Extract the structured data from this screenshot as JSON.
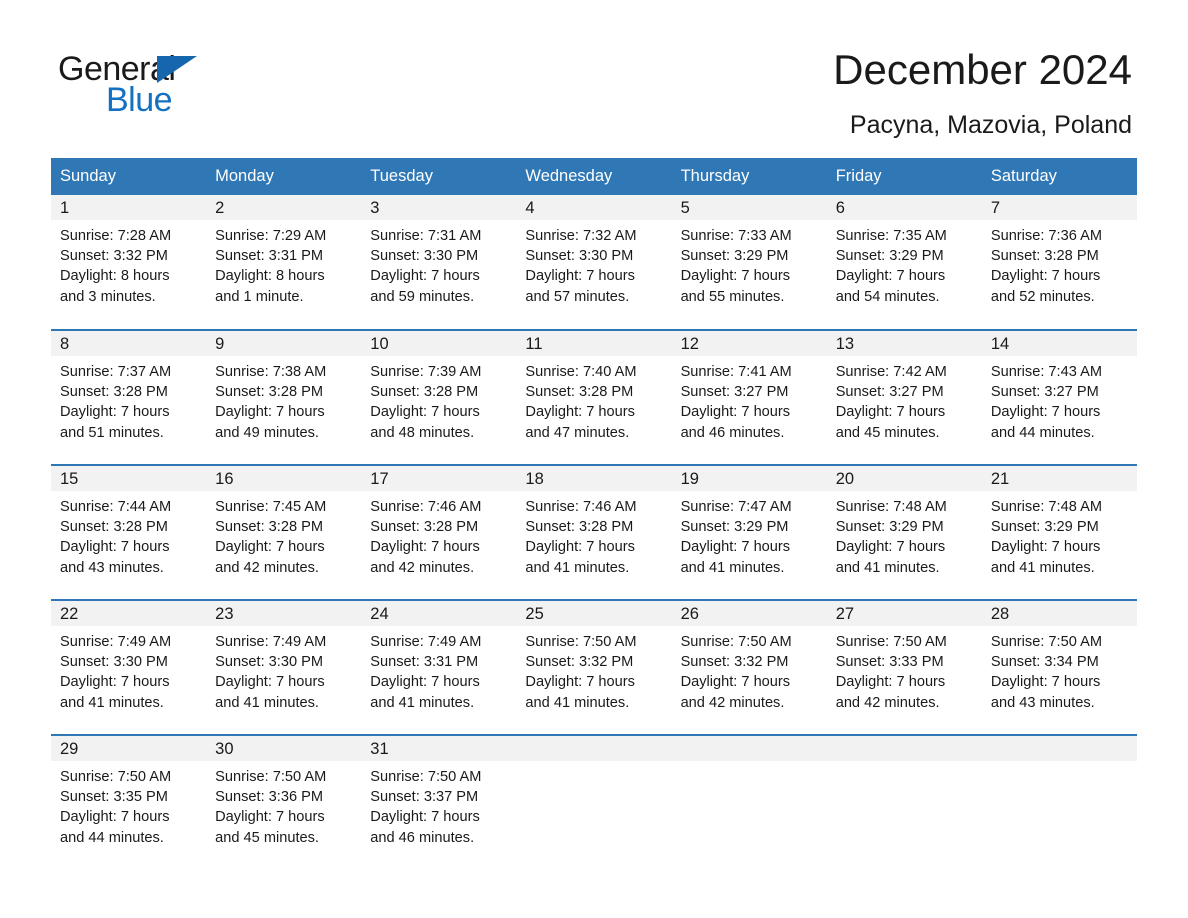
{
  "brand": {
    "name_top": "General",
    "name_bottom": "Blue",
    "accent_color": "#1271c0",
    "triangle_color": "#1566ad"
  },
  "header": {
    "title": "December 2024",
    "location": "Pacyna, Mazovia, Poland"
  },
  "calendar": {
    "header_bg": "#3077b5",
    "header_text_color": "#ffffff",
    "daynum_bg": "#f2f2f2",
    "weekday_headers": [
      "Sunday",
      "Monday",
      "Tuesday",
      "Wednesday",
      "Thursday",
      "Friday",
      "Saturday"
    ],
    "weeks": [
      [
        {
          "day": "1",
          "sunrise": "Sunrise: 7:28 AM",
          "sunset": "Sunset: 3:32 PM",
          "daylight1": "Daylight: 8 hours",
          "daylight2": "and 3 minutes."
        },
        {
          "day": "2",
          "sunrise": "Sunrise: 7:29 AM",
          "sunset": "Sunset: 3:31 PM",
          "daylight1": "Daylight: 8 hours",
          "daylight2": "and 1 minute."
        },
        {
          "day": "3",
          "sunrise": "Sunrise: 7:31 AM",
          "sunset": "Sunset: 3:30 PM",
          "daylight1": "Daylight: 7 hours",
          "daylight2": "and 59 minutes."
        },
        {
          "day": "4",
          "sunrise": "Sunrise: 7:32 AM",
          "sunset": "Sunset: 3:30 PM",
          "daylight1": "Daylight: 7 hours",
          "daylight2": "and 57 minutes."
        },
        {
          "day": "5",
          "sunrise": "Sunrise: 7:33 AM",
          "sunset": "Sunset: 3:29 PM",
          "daylight1": "Daylight: 7 hours",
          "daylight2": "and 55 minutes."
        },
        {
          "day": "6",
          "sunrise": "Sunrise: 7:35 AM",
          "sunset": "Sunset: 3:29 PM",
          "daylight1": "Daylight: 7 hours",
          "daylight2": "and 54 minutes."
        },
        {
          "day": "7",
          "sunrise": "Sunrise: 7:36 AM",
          "sunset": "Sunset: 3:28 PM",
          "daylight1": "Daylight: 7 hours",
          "daylight2": "and 52 minutes."
        }
      ],
      [
        {
          "day": "8",
          "sunrise": "Sunrise: 7:37 AM",
          "sunset": "Sunset: 3:28 PM",
          "daylight1": "Daylight: 7 hours",
          "daylight2": "and 51 minutes."
        },
        {
          "day": "9",
          "sunrise": "Sunrise: 7:38 AM",
          "sunset": "Sunset: 3:28 PM",
          "daylight1": "Daylight: 7 hours",
          "daylight2": "and 49 minutes."
        },
        {
          "day": "10",
          "sunrise": "Sunrise: 7:39 AM",
          "sunset": "Sunset: 3:28 PM",
          "daylight1": "Daylight: 7 hours",
          "daylight2": "and 48 minutes."
        },
        {
          "day": "11",
          "sunrise": "Sunrise: 7:40 AM",
          "sunset": "Sunset: 3:28 PM",
          "daylight1": "Daylight: 7 hours",
          "daylight2": "and 47 minutes."
        },
        {
          "day": "12",
          "sunrise": "Sunrise: 7:41 AM",
          "sunset": "Sunset: 3:27 PM",
          "daylight1": "Daylight: 7 hours",
          "daylight2": "and 46 minutes."
        },
        {
          "day": "13",
          "sunrise": "Sunrise: 7:42 AM",
          "sunset": "Sunset: 3:27 PM",
          "daylight1": "Daylight: 7 hours",
          "daylight2": "and 45 minutes."
        },
        {
          "day": "14",
          "sunrise": "Sunrise: 7:43 AM",
          "sunset": "Sunset: 3:27 PM",
          "daylight1": "Daylight: 7 hours",
          "daylight2": "and 44 minutes."
        }
      ],
      [
        {
          "day": "15",
          "sunrise": "Sunrise: 7:44 AM",
          "sunset": "Sunset: 3:28 PM",
          "daylight1": "Daylight: 7 hours",
          "daylight2": "and 43 minutes."
        },
        {
          "day": "16",
          "sunrise": "Sunrise: 7:45 AM",
          "sunset": "Sunset: 3:28 PM",
          "daylight1": "Daylight: 7 hours",
          "daylight2": "and 42 minutes."
        },
        {
          "day": "17",
          "sunrise": "Sunrise: 7:46 AM",
          "sunset": "Sunset: 3:28 PM",
          "daylight1": "Daylight: 7 hours",
          "daylight2": "and 42 minutes."
        },
        {
          "day": "18",
          "sunrise": "Sunrise: 7:46 AM",
          "sunset": "Sunset: 3:28 PM",
          "daylight1": "Daylight: 7 hours",
          "daylight2": "and 41 minutes."
        },
        {
          "day": "19",
          "sunrise": "Sunrise: 7:47 AM",
          "sunset": "Sunset: 3:29 PM",
          "daylight1": "Daylight: 7 hours",
          "daylight2": "and 41 minutes."
        },
        {
          "day": "20",
          "sunrise": "Sunrise: 7:48 AM",
          "sunset": "Sunset: 3:29 PM",
          "daylight1": "Daylight: 7 hours",
          "daylight2": "and 41 minutes."
        },
        {
          "day": "21",
          "sunrise": "Sunrise: 7:48 AM",
          "sunset": "Sunset: 3:29 PM",
          "daylight1": "Daylight: 7 hours",
          "daylight2": "and 41 minutes."
        }
      ],
      [
        {
          "day": "22",
          "sunrise": "Sunrise: 7:49 AM",
          "sunset": "Sunset: 3:30 PM",
          "daylight1": "Daylight: 7 hours",
          "daylight2": "and 41 minutes."
        },
        {
          "day": "23",
          "sunrise": "Sunrise: 7:49 AM",
          "sunset": "Sunset: 3:30 PM",
          "daylight1": "Daylight: 7 hours",
          "daylight2": "and 41 minutes."
        },
        {
          "day": "24",
          "sunrise": "Sunrise: 7:49 AM",
          "sunset": "Sunset: 3:31 PM",
          "daylight1": "Daylight: 7 hours",
          "daylight2": "and 41 minutes."
        },
        {
          "day": "25",
          "sunrise": "Sunrise: 7:50 AM",
          "sunset": "Sunset: 3:32 PM",
          "daylight1": "Daylight: 7 hours",
          "daylight2": "and 41 minutes."
        },
        {
          "day": "26",
          "sunrise": "Sunrise: 7:50 AM",
          "sunset": "Sunset: 3:32 PM",
          "daylight1": "Daylight: 7 hours",
          "daylight2": "and 42 minutes."
        },
        {
          "day": "27",
          "sunrise": "Sunrise: 7:50 AM",
          "sunset": "Sunset: 3:33 PM",
          "daylight1": "Daylight: 7 hours",
          "daylight2": "and 42 minutes."
        },
        {
          "day": "28",
          "sunrise": "Sunrise: 7:50 AM",
          "sunset": "Sunset: 3:34 PM",
          "daylight1": "Daylight: 7 hours",
          "daylight2": "and 43 minutes."
        }
      ],
      [
        {
          "day": "29",
          "sunrise": "Sunrise: 7:50 AM",
          "sunset": "Sunset: 3:35 PM",
          "daylight1": "Daylight: 7 hours",
          "daylight2": "and 44 minutes."
        },
        {
          "day": "30",
          "sunrise": "Sunrise: 7:50 AM",
          "sunset": "Sunset: 3:36 PM",
          "daylight1": "Daylight: 7 hours",
          "daylight2": "and 45 minutes."
        },
        {
          "day": "31",
          "sunrise": "Sunrise: 7:50 AM",
          "sunset": "Sunset: 3:37 PM",
          "daylight1": "Daylight: 7 hours",
          "daylight2": "and 46 minutes."
        },
        {
          "day": "",
          "sunrise": "",
          "sunset": "",
          "daylight1": "",
          "daylight2": ""
        },
        {
          "day": "",
          "sunrise": "",
          "sunset": "",
          "daylight1": "",
          "daylight2": ""
        },
        {
          "day": "",
          "sunrise": "",
          "sunset": "",
          "daylight1": "",
          "daylight2": ""
        },
        {
          "day": "",
          "sunrise": "",
          "sunset": "",
          "daylight1": "",
          "daylight2": ""
        }
      ]
    ]
  }
}
